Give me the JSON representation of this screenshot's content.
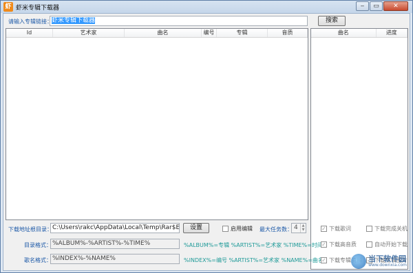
{
  "window": {
    "title": "虾米专辑下载器",
    "app_icon": "虾",
    "minimize": "‒",
    "maximize": "▭",
    "close": "✕"
  },
  "search": {
    "label": "请输入专辑链接：",
    "value": "虾米专辑下载器",
    "button": "搜索"
  },
  "main_list": {
    "columns": [
      "Id",
      "艺术家",
      "曲名",
      "编号",
      "专辑",
      "音质"
    ]
  },
  "progress_list": {
    "columns": [
      "曲名",
      "进度"
    ]
  },
  "download_dir": {
    "label": "下载地址根目录：",
    "value": "C:\\Users\\rakc\\AppData\\Local\\Temp\\Rar$EXa",
    "button": "设置",
    "enable_edit": "启用编辑",
    "max_tasks_label": "最大任务数：",
    "max_tasks_value": "4"
  },
  "dir_format": {
    "label": "目录格式：",
    "value": "%ALBUM%-%ARTIST%-%TIME%",
    "hint": "%ALBUM%=专辑 %ARTIST%=艺术家 %TIME%=时间"
  },
  "name_format": {
    "label": "歌名格式：",
    "value": "%INDEX%-%NAME%",
    "hint": "%INDEX%=编号 %ARTIST%=艺术家 %NAME%=曲名"
  },
  "options": {
    "download_lyrics": "下载歌词",
    "shutdown_after": "下载完成关机",
    "download_hq": "下载高音质",
    "auto_start": "自动开始下载",
    "download_album_info": "下载专辑资料",
    "download_album_cover": "下载专辑图片"
  },
  "watermark": {
    "title": "当下软件园",
    "url": "www.downxia.com"
  }
}
